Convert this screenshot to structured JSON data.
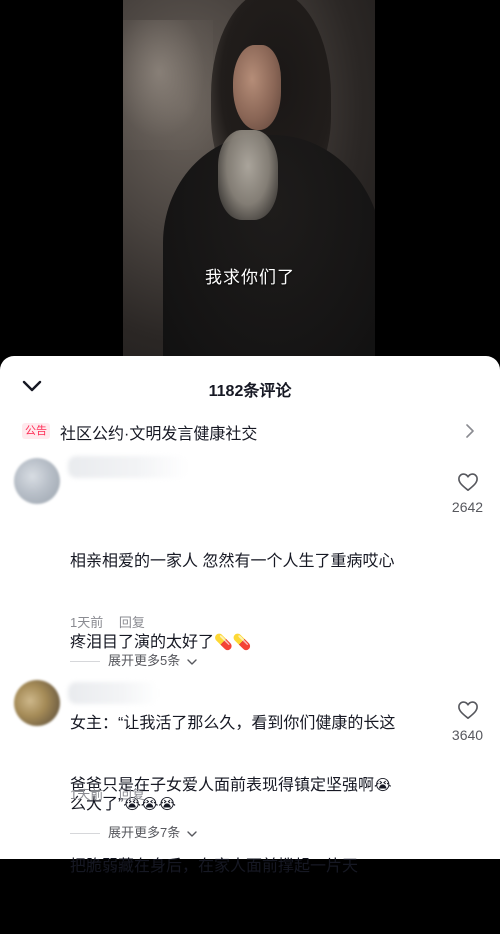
{
  "video": {
    "subtitle": "我求你们了"
  },
  "comments_panel": {
    "title": "1182条评论",
    "notice_badge": "公告",
    "notice_text": "社区公约·文明发言健康社交",
    "icons": {
      "collapse": "chevron-down-icon",
      "notice_arrow": "chevron-right-icon",
      "like": "heart-outline-icon"
    }
  },
  "comments": [
    {
      "line1": "相亲相爱的一家人 忽然有一个人生了重病哎心",
      "line2": "疼泪目了演的太好了",
      "line2_emoji": "💊💊",
      "line3": "女主：“让我活了那么久，看到你们健康的长这",
      "line4": "么大了”",
      "line4_emoji": "😭😭😭",
      "time": "1天前",
      "reply": "回复",
      "likes": "2642",
      "expand": "展开更多5条"
    },
    {
      "line1": "爸爸只是在子女爱人面前表现得镇定坚强啊",
      "line1_emoji": "😭",
      "line2": "把脆弱藏在身后，在家人面前撑起一片天",
      "time": "1天前",
      "reply": "回复",
      "likes": "3640",
      "expand": "展开更多7条"
    }
  ]
}
